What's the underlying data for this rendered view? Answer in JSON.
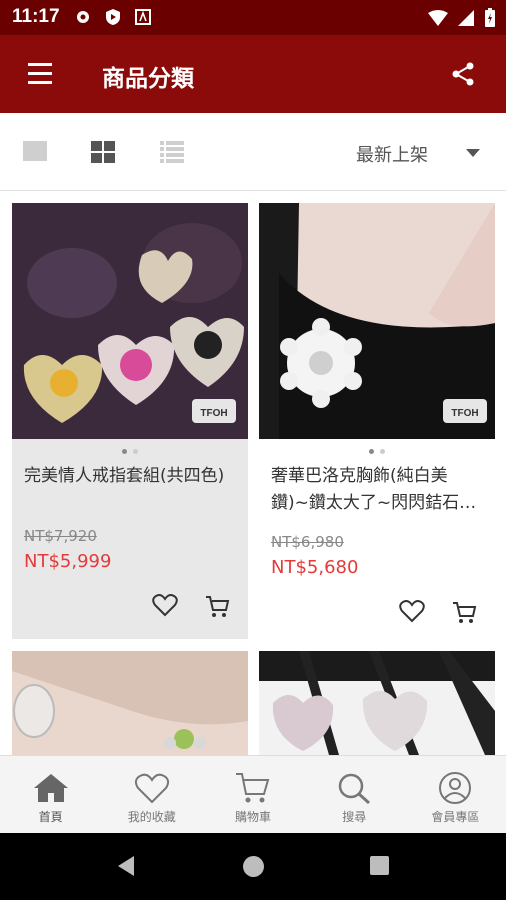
{
  "status": {
    "time": "11:17"
  },
  "app_bar": {
    "title": "商品分類"
  },
  "toolbar": {
    "sort_label": "最新上架"
  },
  "products": [
    {
      "name": "完美情人戒指套組(共四色)",
      "price_old": "NT$7,920",
      "price_new": "NT$5,999"
    },
    {
      "name": "奢華巴洛克胸飾(純白美鑽)~鑽太大了~閃閃銡石…",
      "price_old": "NT$6,980",
      "price_new": "NT$5,680"
    }
  ],
  "bottom_nav": [
    {
      "label": "首頁",
      "icon": "home-icon"
    },
    {
      "label": "我的收藏",
      "icon": "heart-icon"
    },
    {
      "label": "購物車",
      "icon": "cart-icon"
    },
    {
      "label": "搜尋",
      "icon": "search-icon"
    },
    {
      "label": "會員專區",
      "icon": "user-icon"
    }
  ],
  "colors": {
    "primary": "#8b0a0a",
    "status": "#6b0000",
    "price": "#e53a3a"
  }
}
